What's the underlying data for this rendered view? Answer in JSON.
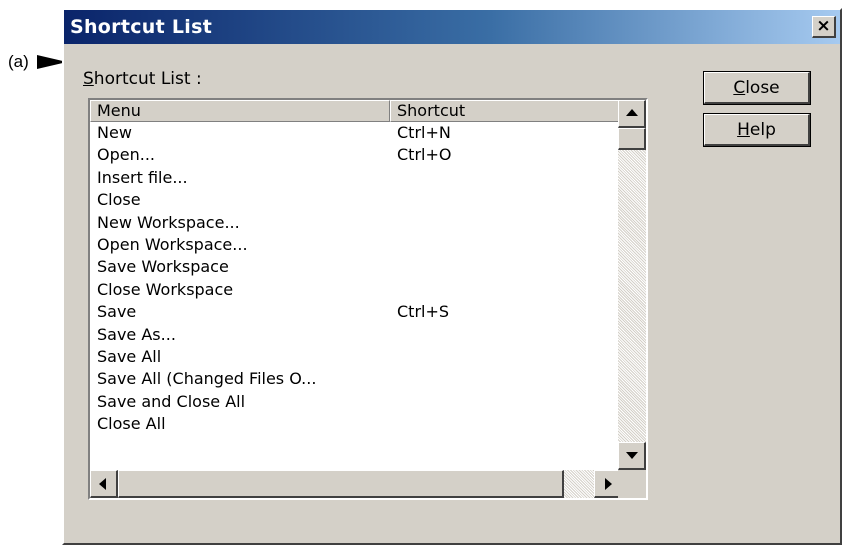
{
  "annotation": {
    "label": "(a)"
  },
  "dialog": {
    "title": "Shortcut List",
    "close_glyph": "×",
    "list_label_mnemonic": "S",
    "list_label_rest": "hortcut List :"
  },
  "buttons": {
    "close_mnemonic": "C",
    "close_rest": "lose",
    "help_mnemonic": "H",
    "help_rest": "elp"
  },
  "table": {
    "columns": [
      "Menu",
      "Shortcut"
    ],
    "rows": [
      {
        "menu": "New",
        "shortcut": "Ctrl+N"
      },
      {
        "menu": "Open...",
        "shortcut": "Ctrl+O"
      },
      {
        "menu": "Insert file...",
        "shortcut": ""
      },
      {
        "menu": "Close",
        "shortcut": ""
      },
      {
        "menu": "New Workspace...",
        "shortcut": ""
      },
      {
        "menu": "Open Workspace...",
        "shortcut": ""
      },
      {
        "menu": "Save Workspace",
        "shortcut": ""
      },
      {
        "menu": "Close Workspace",
        "shortcut": ""
      },
      {
        "menu": "Save",
        "shortcut": "Ctrl+S"
      },
      {
        "menu": "Save As...",
        "shortcut": ""
      },
      {
        "menu": "Save All",
        "shortcut": ""
      },
      {
        "menu": "Save All (Changed Files O...",
        "shortcut": ""
      },
      {
        "menu": "Save and Close All",
        "shortcut": ""
      },
      {
        "menu": "Close All",
        "shortcut": ""
      }
    ]
  }
}
